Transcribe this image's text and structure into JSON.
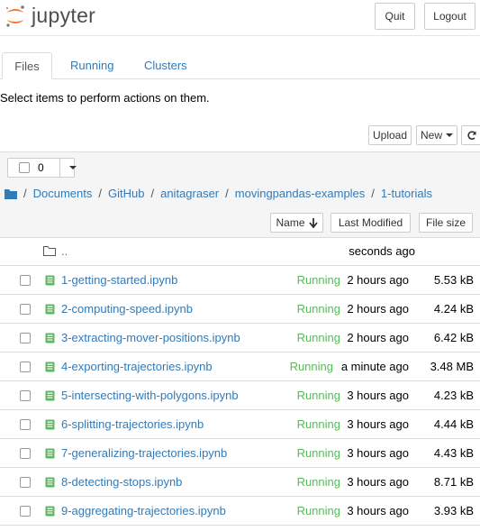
{
  "header": {
    "logo_text": "jupyter",
    "quit_label": "Quit",
    "logout_label": "Logout"
  },
  "tabs": [
    {
      "label": "Files",
      "active": true
    },
    {
      "label": "Running",
      "active": false
    },
    {
      "label": "Clusters",
      "active": false
    }
  ],
  "instructions": "Select items to perform actions on them.",
  "toolbar": {
    "upload_label": "Upload",
    "new_label": "New",
    "refresh_icon": "refresh-icon"
  },
  "selection": {
    "count": "0"
  },
  "breadcrumb": {
    "root_icon": "folder-icon",
    "items": [
      "Documents",
      "GitHub",
      "anitagraser",
      "movingpandas-examples",
      "1-tutorials"
    ]
  },
  "sort": {
    "name_label": "Name",
    "modified_label": "Last Modified",
    "size_label": "File size"
  },
  "parent_row": {
    "name": "..",
    "modified": "seconds ago"
  },
  "files": [
    {
      "name": "1-getting-started.ipynb",
      "status": "Running",
      "modified": "2 hours ago",
      "size": "5.53 kB"
    },
    {
      "name": "2-computing-speed.ipynb",
      "status": "Running",
      "modified": "2 hours ago",
      "size": "4.24 kB"
    },
    {
      "name": "3-extracting-mover-positions.ipynb",
      "status": "Running",
      "modified": "2 hours ago",
      "size": "6.42 kB"
    },
    {
      "name": "4-exporting-trajectories.ipynb",
      "status": "Running",
      "modified": "a minute ago",
      "size": "3.48 MB"
    },
    {
      "name": "5-intersecting-with-polygons.ipynb",
      "status": "Running",
      "modified": "3 hours ago",
      "size": "4.23 kB"
    },
    {
      "name": "6-splitting-trajectories.ipynb",
      "status": "Running",
      "modified": "3 hours ago",
      "size": "4.44 kB"
    },
    {
      "name": "7-generalizing-trajectories.ipynb",
      "status": "Running",
      "modified": "3 hours ago",
      "size": "4.43 kB"
    },
    {
      "name": "8-detecting-stops.ipynb",
      "status": "Running",
      "modified": "3 hours ago",
      "size": "8.71 kB"
    },
    {
      "name": "9-aggregating-trajectories.ipynb",
      "status": "Running",
      "modified": "3 hours ago",
      "size": "3.93 kB"
    }
  ],
  "colors": {
    "link": "#337ab7",
    "running": "#5cb85c",
    "logo_orange": "#F37726"
  }
}
